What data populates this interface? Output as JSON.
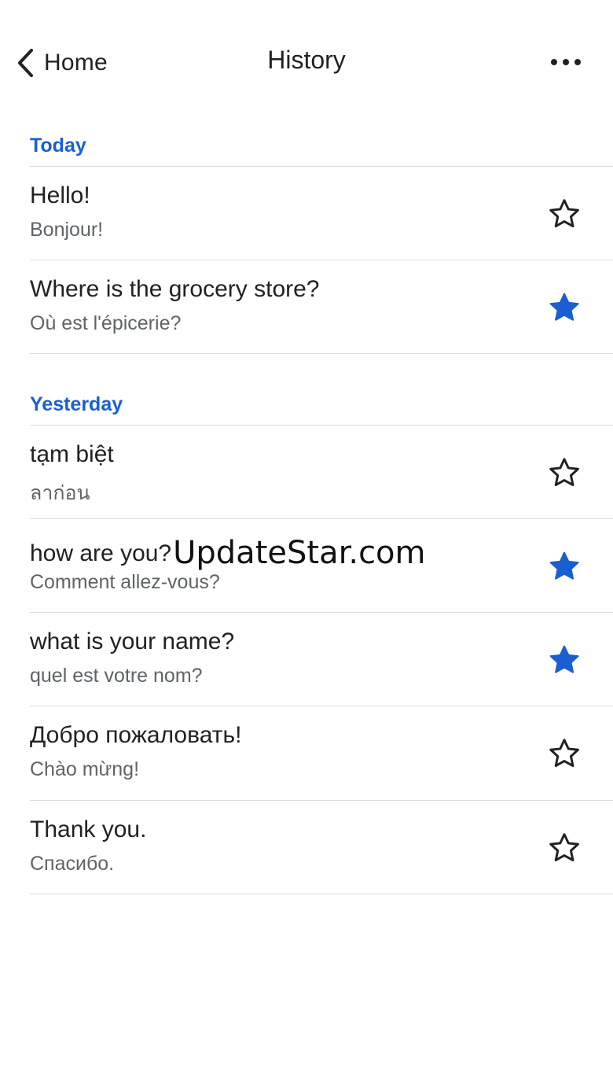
{
  "nav": {
    "back_label": "Home",
    "title": "History",
    "back_icon": "chevron-left-icon",
    "more_icon": "more-horizontal-icon"
  },
  "colors": {
    "accent": "#1a5fd1",
    "primary_text": "#202124",
    "secondary_text": "#5f6368",
    "divider": "#dadce0"
  },
  "sections": [
    {
      "label": "Today",
      "items": [
        {
          "source": "Hello!",
          "translation": "Bonjour!",
          "starred": false
        },
        {
          "source": "Where is the grocery store?",
          "translation": "Où est l'épicerie?",
          "starred": true
        }
      ]
    },
    {
      "label": "Yesterday",
      "items": [
        {
          "source": "tạm biệt",
          "translation": "ลาก่อน",
          "starred": false
        },
        {
          "source": "how are you?",
          "source_overlay": "UpdateStar.com",
          "translation": "Comment allez-vous?",
          "starred": true
        },
        {
          "source": "what is your name?",
          "translation": "quel est votre nom?",
          "starred": true
        },
        {
          "source": "Добро пожаловать!",
          "translation": "Chào mừng!",
          "starred": false
        },
        {
          "source": "Thank you.",
          "translation": "Спасибо.",
          "starred": false
        }
      ]
    }
  ]
}
